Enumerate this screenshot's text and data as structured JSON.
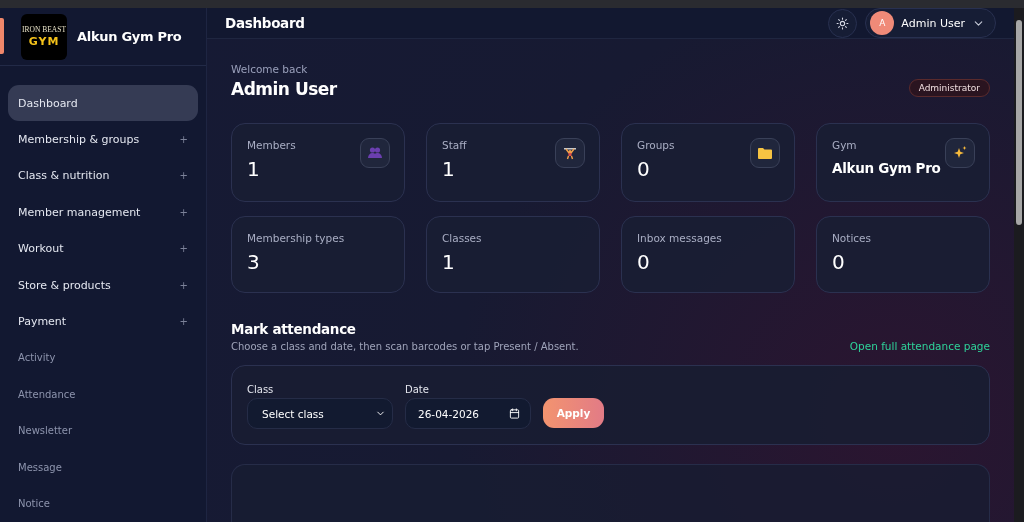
{
  "brand": {
    "logo_top": "IRON BEAST",
    "logo_bottom": "GYM",
    "name": "Alkun Gym Pro"
  },
  "sidebar": {
    "items": [
      {
        "label": "Dashboard",
        "kind": "link",
        "selected": true
      },
      {
        "label": "Membership & groups",
        "kind": "group",
        "selected": false,
        "toggle": "+"
      },
      {
        "label": "Class & nutrition",
        "kind": "group",
        "selected": false,
        "toggle": "+"
      },
      {
        "label": "Member management",
        "kind": "group",
        "selected": false,
        "toggle": "+"
      },
      {
        "label": "Workout",
        "kind": "group",
        "selected": false,
        "toggle": "+"
      },
      {
        "label": "Store & products",
        "kind": "group",
        "selected": false,
        "toggle": "+"
      },
      {
        "label": "Payment",
        "kind": "group",
        "selected": false,
        "toggle": "+"
      },
      {
        "label": "Activity",
        "kind": "link",
        "selected": false
      },
      {
        "label": "Attendance",
        "kind": "link",
        "selected": false
      },
      {
        "label": "Newsletter",
        "kind": "link",
        "selected": false
      },
      {
        "label": "Message",
        "kind": "link",
        "selected": false
      },
      {
        "label": "Notice",
        "kind": "link",
        "selected": false
      }
    ]
  },
  "header": {
    "title": "Dashboard",
    "user": {
      "initial": "A",
      "name": "Admin User"
    }
  },
  "welcome": {
    "greeting": "Welcome back",
    "name": "Admin User",
    "role": "Administrator"
  },
  "stats": [
    {
      "label": "Members",
      "value": "1",
      "kind": "number"
    },
    {
      "label": "Staff",
      "value": "1",
      "kind": "number"
    },
    {
      "label": "Groups",
      "value": "0",
      "kind": "number"
    },
    {
      "label": "Gym",
      "value": "Alkun Gym Pro",
      "kind": "name"
    },
    {
      "label": "Membership types",
      "value": "3",
      "kind": "number"
    },
    {
      "label": "Classes",
      "value": "1",
      "kind": "number"
    },
    {
      "label": "Inbox messages",
      "value": "0",
      "kind": "number"
    },
    {
      "label": "Notices",
      "value": "0",
      "kind": "number"
    }
  ],
  "attendance": {
    "title": "Mark attendance",
    "subtitle": "Choose a class and date, then scan barcodes or tap Present / Absent.",
    "link": "Open full attendance page",
    "class_label": "Class",
    "class_value": "Select class",
    "date_label": "Date",
    "date_value": "26-04-2026",
    "apply": "Apply"
  }
}
